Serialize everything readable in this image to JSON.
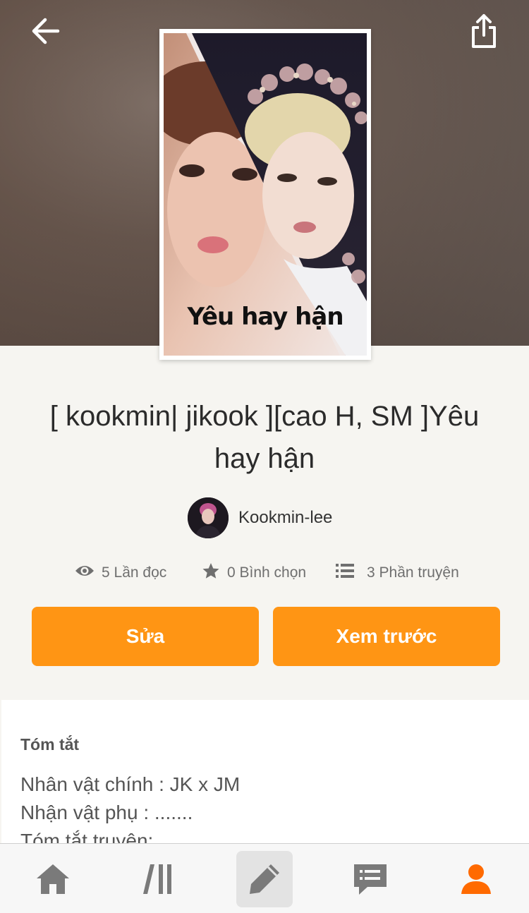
{
  "cover": {
    "title_text": "Yêu hay hận"
  },
  "story": {
    "title": "[ kookmin| jikook ][cao H, SM ]Yêu hay hận"
  },
  "author": {
    "name": "Kookmin-lee"
  },
  "stats": {
    "reads": "5 Lần đọc",
    "votes": "0 Bình chọn",
    "parts": "3 Phần truyện"
  },
  "actions": {
    "edit": "Sửa",
    "preview": "Xem trước"
  },
  "summary": {
    "heading": "Tóm tắt",
    "lines": [
      "Nhân vật chính : JK x JM",
      "Nhận vật phụ : .......",
      "Tóm tắt truyện:"
    ]
  },
  "nav": {
    "items": [
      {
        "icon": "home-icon"
      },
      {
        "icon": "library-icon"
      },
      {
        "icon": "write-icon",
        "active": true
      },
      {
        "icon": "messages-icon"
      },
      {
        "icon": "profile-icon"
      }
    ]
  },
  "colors": {
    "accent": "#ff9514",
    "background": "#f6f5f1",
    "profile_active": "#ff6a00"
  }
}
